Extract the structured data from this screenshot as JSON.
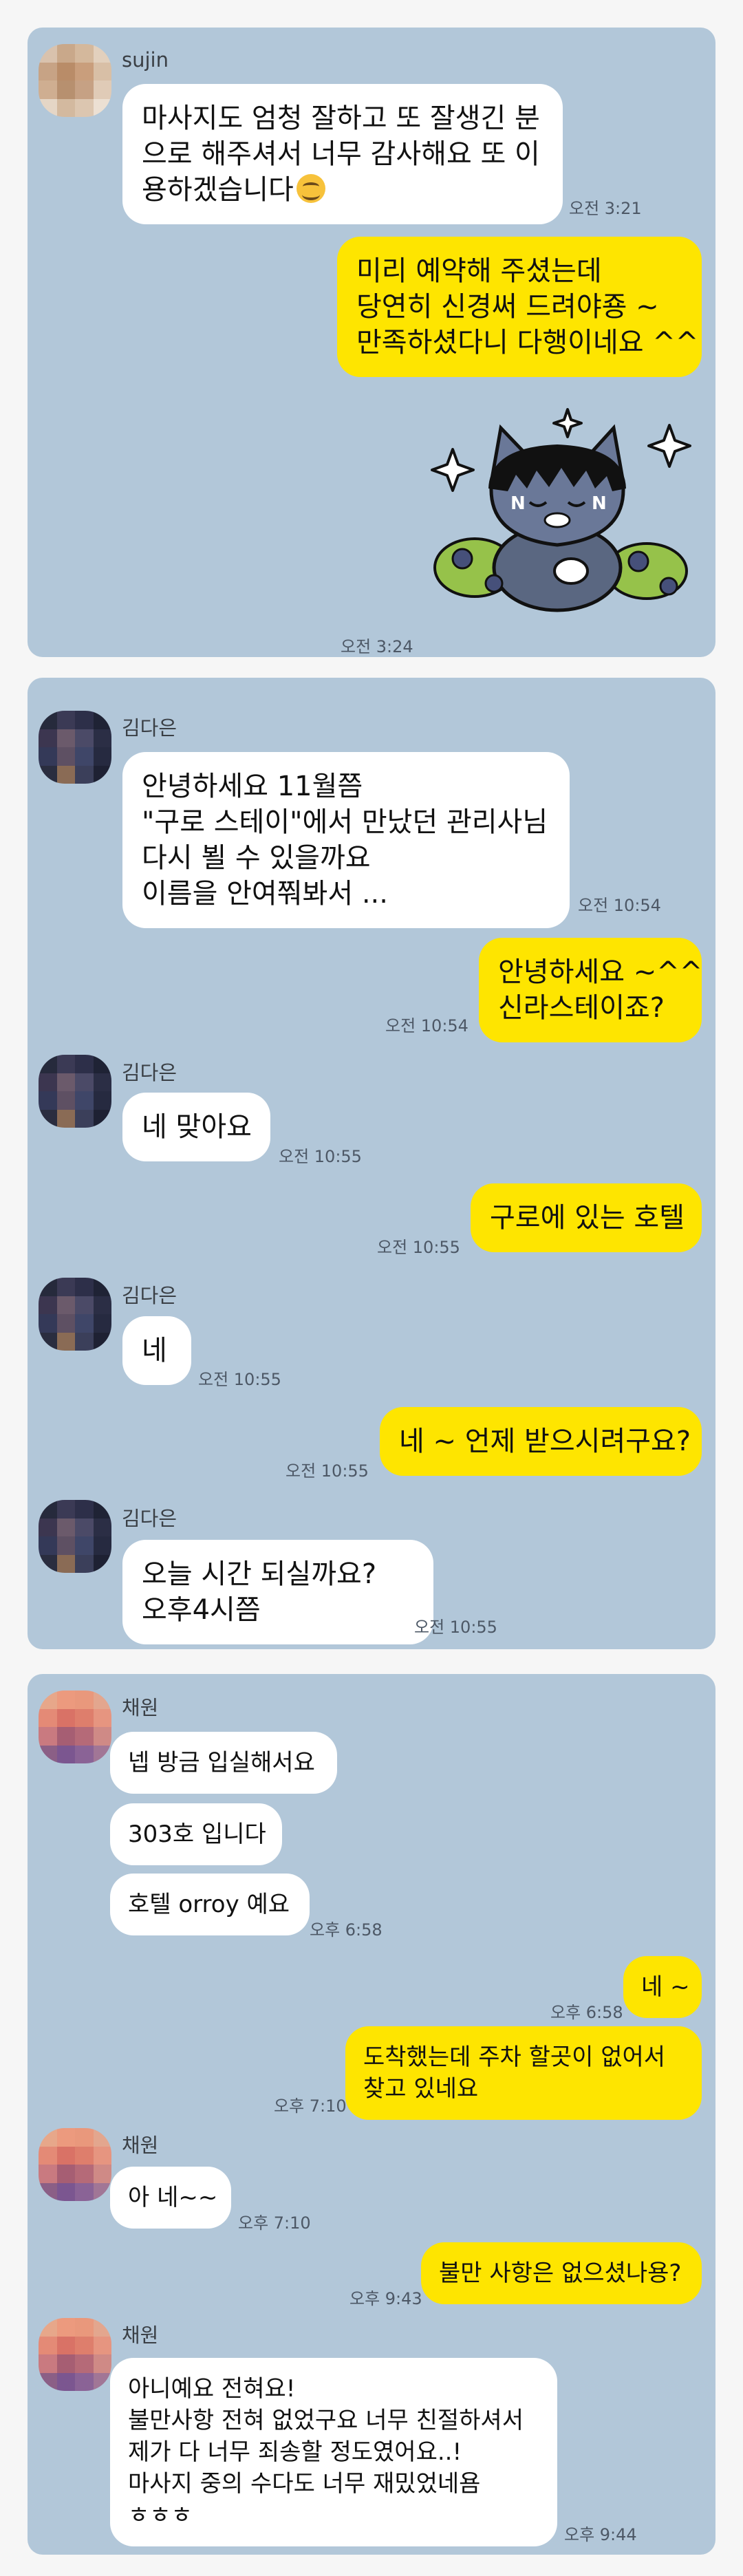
{
  "panel1": {
    "sender_name": "sujin",
    "msg1": {
      "lines": [
        "마사지도 엄청 잘하고 또 잘생긴 분",
        "으로 해주셔서 너무 감사해요 또 이",
        "용하겠습니다"
      ],
      "emoji": "smiling-face",
      "time": "오전 3:21"
    },
    "reply1": {
      "lines": [
        "미리 예약해 주셨는데",
        "당연히 신경써 드려야죵 ~",
        "만족하셨다니 다행이네요 ^^"
      ]
    },
    "sticker": {
      "name": "cat-sticker",
      "time": "오전 3:24"
    }
  },
  "panel2": {
    "sender_name": "김다은",
    "m1": {
      "lines": [
        "안녕하세요 11월쯤",
        "\"구로 스테이\"에서 만났던 관리사님",
        "다시 뵐 수 있을까요",
        "이름을 안여쭤봐서 ..."
      ],
      "time": "오전 10:54"
    },
    "r1": {
      "lines": [
        "안녕하세요 ~^^",
        "신라스테이죠?"
      ],
      "time": "오전 10:54"
    },
    "m2": {
      "text": "네 맞아요",
      "time": "오전 10:55"
    },
    "r2": {
      "text": "구로에 있는 호텔",
      "time": "오전 10:55"
    },
    "m3": {
      "text": "네",
      "time": "오전 10:55"
    },
    "r3": {
      "text": "네 ~ 언제 받으시려구요?",
      "time": "오전 10:55"
    },
    "m4": {
      "lines": [
        "오늘  시간 되실까요?",
        "오후4시쯤"
      ],
      "time": "오전 10:55"
    }
  },
  "panel3": {
    "sender_name": "채원",
    "m1": {
      "text": "넵 방금 입실해서요"
    },
    "m2": {
      "text": "303호 입니다"
    },
    "m3": {
      "text": "호텔 orroy 예요",
      "time": "오후 6:58"
    },
    "r1": {
      "text": "네 ~",
      "time": "오후 6:58"
    },
    "r2": {
      "lines": [
        "도착했는데  주차 할곳이 없어서",
        "찾고 있네요"
      ],
      "time": "오후 7:10"
    },
    "m4": {
      "text": "아 네~~",
      "time": "오후 7:10"
    },
    "r3": {
      "text": "불만 사항은 없으셨나용?",
      "time": "오후 9:43"
    },
    "m5": {
      "lines": [
        "아니예요 전혀요!",
        "불만사항 전혀 없었구요 너무 친절하셔서",
        "제가 다 너무 죄송할 정도였어요..!",
        "마사지 중의 수다도 너무 재밌었네욤",
        "ㅎㅎㅎ"
      ],
      "time": "오후 9:44"
    }
  },
  "colors": {
    "chat_bg": "#b2c7d9",
    "incoming": "#ffffff",
    "outgoing": "#fee500"
  }
}
